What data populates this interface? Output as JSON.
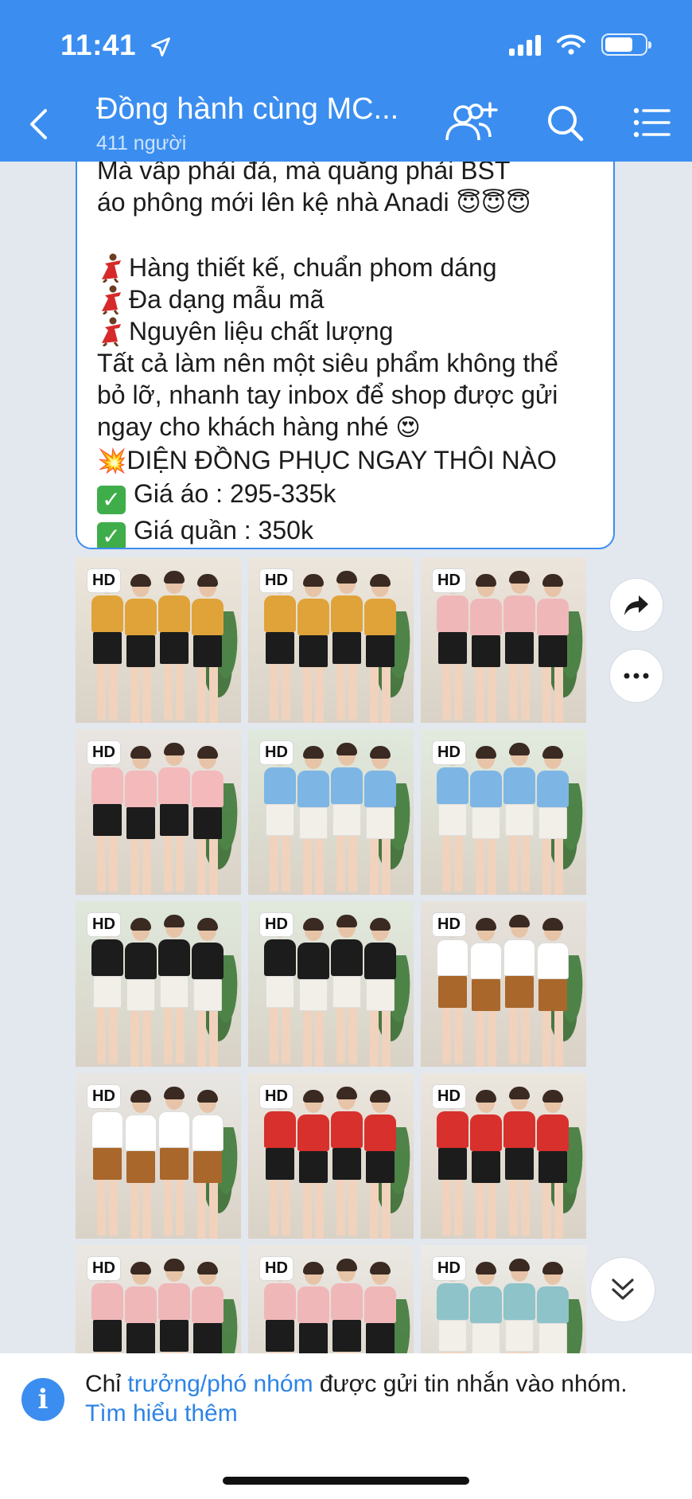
{
  "status_bar": {
    "time": "11:41"
  },
  "header": {
    "title": "Đồng hành cùng MC...",
    "member_count": "411 người"
  },
  "message": {
    "lines": [
      "Mà vấp phải đá, mà quăng phải BST",
      "áo phông mới lên kệ nhà Anadi",
      "",
      "Hàng thiết kế, chuẩn phom dáng",
      "Đa dạng mẫu mã",
      "Nguyên liệu chất lượng",
      "Tất cả làm nên một siêu phẩm không thể",
      "bỏ lỡ, nhanh tay inbox để shop được gửi",
      "ngay cho khách hàng nhé",
      "DIỆN ĐỒNG PHỤC NGAY THÔI NÀO",
      "Giá áo : 295-335k",
      "Giá quần : 350k"
    ]
  },
  "photos": {
    "hd_label": "HD",
    "items": [
      {
        "shirt": "#e0a33a",
        "pants": "#1c1c1c",
        "bg": "#ece6dc",
        "n": 4
      },
      {
        "shirt": "#e0a33a",
        "pants": "#1c1c1c",
        "bg": "#ece6dc",
        "n": 4
      },
      {
        "shirt": "#f0b7b9",
        "pants": "#1c1c1c",
        "bg": "#ebe5dc",
        "n": 4
      },
      {
        "shirt": "#f3b9bb",
        "pants": "#1c1c1c",
        "bg": "#e9e5e1",
        "n": 4
      },
      {
        "shirt": "#7db6e4",
        "pants": "#f2efe8",
        "bg": "#dfe9dc",
        "n": 4
      },
      {
        "shirt": "#7db6e4",
        "pants": "#f2efe8",
        "bg": "#e2ebdf",
        "n": 4
      },
      {
        "shirt": "#1c1c1c",
        "pants": "#f2efe8",
        "bg": "#dfe8dc",
        "n": 4
      },
      {
        "shirt": "#1c1c1c",
        "pants": "#f2efe8",
        "bg": "#e1e9dd",
        "n": 4
      },
      {
        "shirt": "#ffffff",
        "pants": "#a9672b",
        "bg": "#e6e2dc",
        "n": 4
      },
      {
        "shirt": "#ffffff",
        "pants": "#a9672b",
        "bg": "#e8e6e3",
        "n": 4
      },
      {
        "shirt": "#d8302c",
        "pants": "#1c1c1c",
        "bg": "#ebe6de",
        "n": 4
      },
      {
        "shirt": "#d8302c",
        "pants": "#1c1c1c",
        "bg": "#ebe6de",
        "n": 4
      },
      {
        "shirt": "#f0b7b9",
        "pants": "#1c1c1c",
        "bg": "#ebe8e3",
        "n": 4
      },
      {
        "shirt": "#f0b7b9",
        "pants": "#1c1c1c",
        "bg": "#ebe8e3",
        "n": 4
      },
      {
        "shirt": "#8ec3c9",
        "pants": "#f2efe8",
        "bg": "#ecebe7",
        "n": 4
      }
    ]
  },
  "notice": {
    "prefix": "Chỉ ",
    "link_role": "trưởng/phó nhóm",
    "suffix": " được gửi tin nhắn vào nhóm.",
    "learn_more": "Tìm hiểu thêm"
  },
  "colors": {
    "accent": "#3b8ef0",
    "link": "#2d84e6",
    "background": "#e3e7ee"
  },
  "icons": [
    "location-arrow-icon",
    "signal-icon",
    "wifi-icon",
    "battery-icon",
    "back-icon",
    "add-member-icon",
    "search-icon",
    "menu-icon",
    "share-icon",
    "more-icon",
    "scroll-down-icon",
    "info-icon"
  ]
}
